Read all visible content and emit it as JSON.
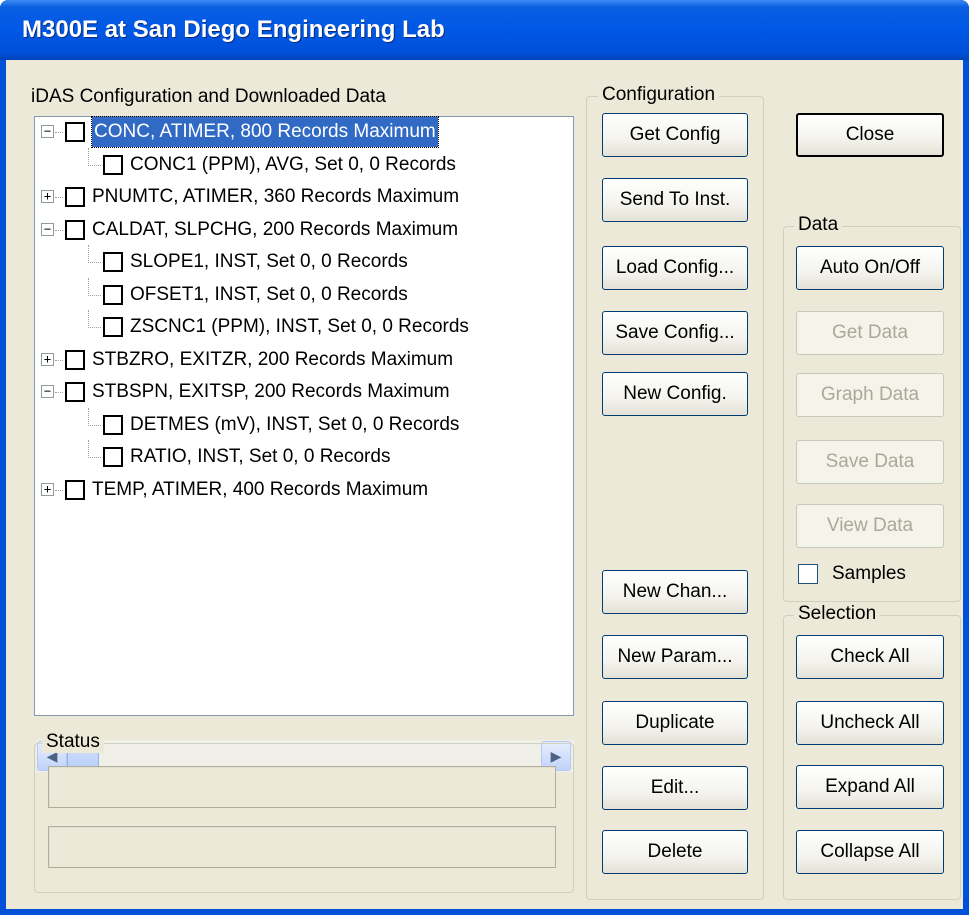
{
  "window": {
    "title": "M300E at San Diego Engineering Lab"
  },
  "tree_panel": {
    "label": "iDAS Configuration and Downloaded Data",
    "rows": [
      {
        "text": "CONC, ATIMER, 800 Records Maximum",
        "level": 0,
        "expander": "⊟",
        "selected": true
      },
      {
        "text": "CONC1 (PPM), AVG, Set 0, 0 Records",
        "level": 1
      },
      {
        "text": "PNUMTC, ATIMER, 360 Records Maximum",
        "level": 0,
        "expander": "⊞"
      },
      {
        "text": "CALDAT, SLPCHG, 200 Records Maximum",
        "level": 0,
        "expander": "⊟"
      },
      {
        "text": "SLOPE1, INST, Set 0, 0 Records",
        "level": 1
      },
      {
        "text": "OFSET1, INST, Set 0, 0 Records",
        "level": 1
      },
      {
        "text": "ZSCNC1 (PPM), INST, Set 0, 0 Records",
        "level": 1
      },
      {
        "text": "STBZRO, EXITZR, 200 Records Maximum",
        "level": 0,
        "expander": "⊞"
      },
      {
        "text": "STBSPN, EXITSP, 200 Records Maximum",
        "level": 0,
        "expander": "⊟"
      },
      {
        "text": "DETMES (mV), INST, Set 0, 0 Records",
        "level": 1
      },
      {
        "text": "RATIO, INST, Set 0, 0 Records",
        "level": 1
      },
      {
        "text": "TEMP, ATIMER, 400 Records Maximum",
        "level": 0,
        "expander": "⊞"
      }
    ],
    "scroll_left": "◀",
    "scroll_right": "▶"
  },
  "status": {
    "label": "Status",
    "line1": "",
    "line2": ""
  },
  "configuration": {
    "label": "Configuration",
    "get_config": "Get Config",
    "send_to_inst": "Send To Inst.",
    "load_config": "Load Config...",
    "save_config": "Save Config...",
    "new_config": "New Config.",
    "new_chan": "New Chan...",
    "new_param": "New Param...",
    "duplicate": "Duplicate",
    "edit": "Edit...",
    "delete": "Delete"
  },
  "close_button": "Close",
  "data_group": {
    "label": "Data",
    "auto_on_off": "Auto On/Off",
    "get_data": "Get Data",
    "graph_data": "Graph Data",
    "save_data": "Save Data",
    "view_data": "View Data",
    "samples_label": "Samples",
    "samples_checked": false
  },
  "selection_group": {
    "label": "Selection",
    "check_all": "Check All",
    "uncheck_all": "Uncheck All",
    "expand_all": "Expand All",
    "collapse_all": "Collapse All"
  }
}
